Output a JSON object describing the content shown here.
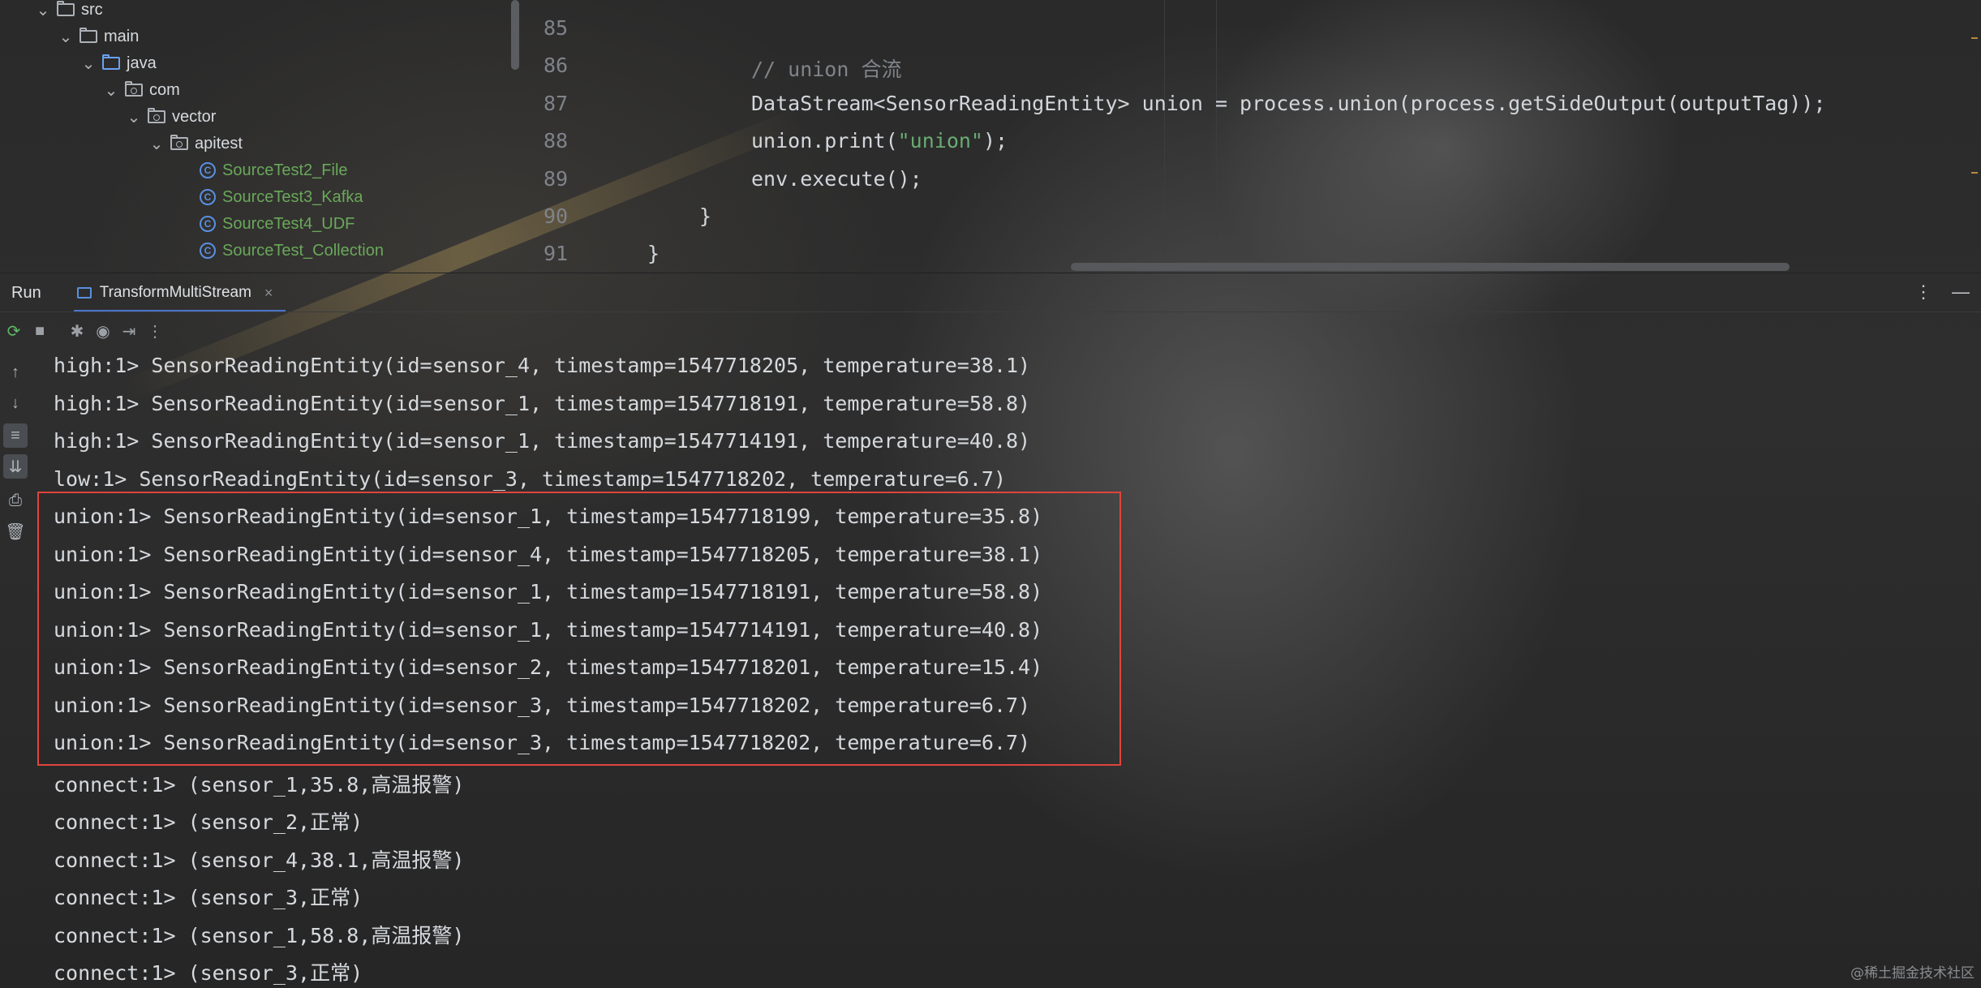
{
  "project_tree": {
    "items": [
      {
        "label": "src",
        "type": "folder",
        "expanded": true
      },
      {
        "label": "main",
        "type": "folder",
        "expanded": true
      },
      {
        "label": "java",
        "type": "source-folder",
        "expanded": true
      },
      {
        "label": "com",
        "type": "package",
        "expanded": true
      },
      {
        "label": "vector",
        "type": "package",
        "expanded": true
      },
      {
        "label": "apitest",
        "type": "package",
        "expanded": true
      },
      {
        "label": "SourceTest2_File",
        "type": "class"
      },
      {
        "label": "SourceTest3_Kafka",
        "type": "class"
      },
      {
        "label": "SourceTest4_UDF",
        "type": "class"
      },
      {
        "label": "SourceTest_Collection",
        "type": "class"
      }
    ]
  },
  "editor": {
    "lines": [
      {
        "num": "85",
        "code": ""
      },
      {
        "num": "86",
        "comment": "// union 合流"
      },
      {
        "num": "87",
        "code": "DataStream<SensorReadingEntity> union = process.union(process.getSideOutput(outputTag));"
      },
      {
        "num": "88",
        "code_pre": "union.print(",
        "string": "\"union\"",
        "code_post": ");"
      },
      {
        "num": "89",
        "code": "env.execute();"
      },
      {
        "num": "90",
        "code": "}"
      },
      {
        "num": "91",
        "code": "}"
      }
    ]
  },
  "run_window": {
    "title": "Run",
    "tab_label": "TransformMultiStream",
    "tab_close": "×",
    "more_icon": "⋮",
    "minimize_icon": "—"
  },
  "console": {
    "lines": [
      "high:1> SensorReadingEntity(id=sensor_4, timestamp=1547718205, temperature=38.1)",
      "high:1> SensorReadingEntity(id=sensor_1, timestamp=1547718191, temperature=58.8)",
      "high:1> SensorReadingEntity(id=sensor_1, timestamp=1547714191, temperature=40.8)",
      "low:1> SensorReadingEntity(id=sensor_3, timestamp=1547718202, temperature=6.7)",
      "union:1> SensorReadingEntity(id=sensor_1, timestamp=1547718199, temperature=35.8)",
      "union:1> SensorReadingEntity(id=sensor_4, timestamp=1547718205, temperature=38.1)",
      "union:1> SensorReadingEntity(id=sensor_1, timestamp=1547718191, temperature=58.8)",
      "union:1> SensorReadingEntity(id=sensor_1, timestamp=1547714191, temperature=40.8)",
      "union:1> SensorReadingEntity(id=sensor_2, timestamp=1547718201, temperature=15.4)",
      "union:1> SensorReadingEntity(id=sensor_3, timestamp=1547718202, temperature=6.7)",
      "union:1> SensorReadingEntity(id=sensor_3, timestamp=1547718202, temperature=6.7)",
      "connect:1> (sensor_1,35.8,高温报警)",
      "connect:1> (sensor_2,正常)",
      "connect:1> (sensor_4,38.1,高温报警)",
      "connect:1> (sensor_3,正常)",
      "connect:1> (sensor_1,58.8,高温报警)",
      "connect:1> (sensor_3,正常)"
    ]
  },
  "watermark": "@稀土掘金技术社区",
  "colors": {
    "highlight_box": "#e0443b",
    "string": "#6aab73",
    "class_label": "#6aa85a",
    "accent": "#4b74c9"
  }
}
